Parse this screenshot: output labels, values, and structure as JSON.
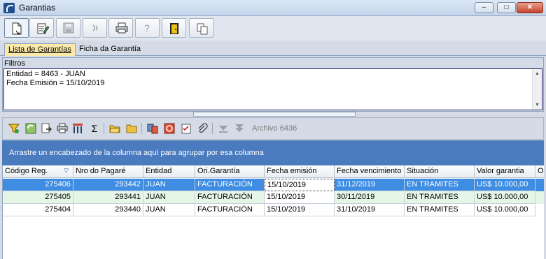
{
  "window": {
    "title": "Garantias",
    "controls": {
      "minimize": "–",
      "maximize": "□",
      "close": "✕"
    }
  },
  "toolbar": {
    "buttons": [
      {
        "name": "new-document-icon"
      },
      {
        "name": "edit-document-icon"
      },
      {
        "name": "save-icon"
      },
      {
        "name": "refresh-icon"
      },
      {
        "name": "print-icon"
      },
      {
        "name": "help-icon",
        "text": "?"
      },
      {
        "name": "exit-door-icon"
      },
      {
        "name": "copy-icon"
      }
    ]
  },
  "tabs": [
    {
      "label": "Lista de Garantías",
      "active": true
    },
    {
      "label": "Ficha da Garantía",
      "active": false
    }
  ],
  "filters": {
    "label": "Filtros",
    "lines": [
      "Entidad = 8463 - JUAN",
      "Fecha Emisión = 15/10/2019"
    ]
  },
  "grid_toolbar": {
    "icons": [
      "filter-icon",
      "refresh-icon",
      "export-icon",
      "print-icon",
      "columns-icon",
      "sigma-icon",
      "open-folder-icon",
      "folder-icon",
      "copy-records-icon",
      "cancel-icon",
      "checklist-icon",
      "attachment-icon",
      "move-down-icon",
      "move-bottom-icon"
    ],
    "archivo": "Archivo 6436"
  },
  "group_hint": "Arrastre un encabezado de la columna aquí para agrupar por esa columna",
  "table": {
    "columns": [
      "Código Reg.",
      "Nro do Pagaré",
      "Entidad",
      "Ori.Garantía",
      "Fecha emisión",
      "Fecha vencimiento",
      "Situación",
      "Valor garantia",
      "O"
    ],
    "rows": [
      [
        "275406",
        "293442",
        "JUAN",
        "FACTURACIÓN",
        "15/10/2019",
        "31/12/2019",
        "EN TRAMITES",
        "US$ 10.000,00"
      ],
      [
        "275405",
        "293441",
        "JUAN",
        "FACTURACIÓN",
        "15/10/2019",
        "30/11/2019",
        "EN TRAMITES",
        "US$ 10.000,00"
      ],
      [
        "275404",
        "293440",
        "JUAN",
        "FACTURACIÓN",
        "15/10/2019",
        "31/10/2019",
        "EN TRAMITES",
        "US$ 10.000,00"
      ]
    ],
    "sort_indicator": "▽"
  },
  "colors": {
    "accent": "#4a7bbf",
    "selected_row": "#3e8de3",
    "alt_row": "#e5f6e6",
    "active_tab": "#fbe9a8"
  }
}
